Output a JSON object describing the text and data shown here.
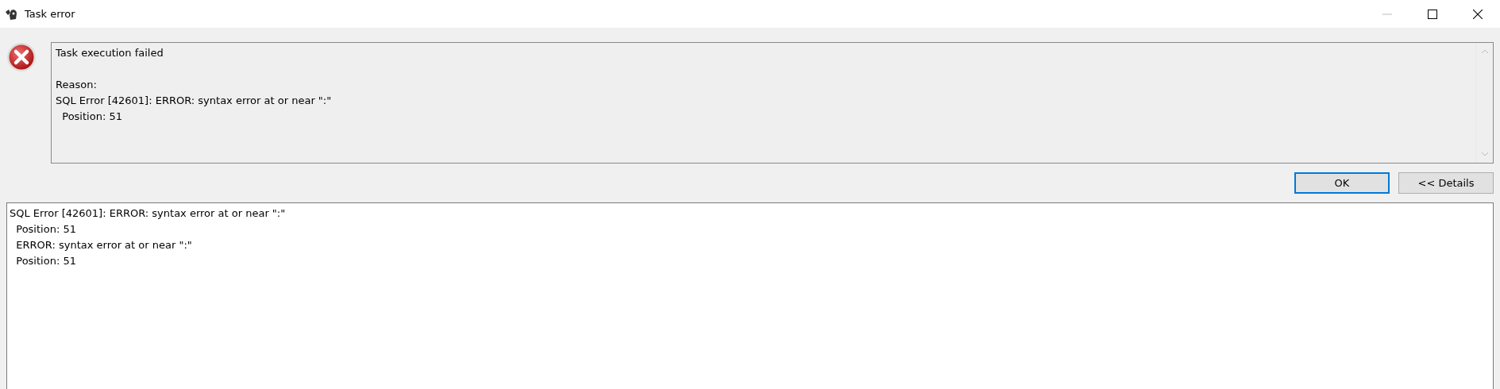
{
  "window": {
    "title": "Task error"
  },
  "message": {
    "headline": "Task execution failed",
    "reason_label": "Reason:",
    "lines": [
      "SQL Error [42601]: ERROR: syntax error at or near \":\"",
      "  Position: 51"
    ]
  },
  "buttons": [
    {
      "label": "OK",
      "default": true
    },
    {
      "label": "<< Details",
      "default": false
    }
  ],
  "details": {
    "lines": [
      "SQL Error [42601]: ERROR: syntax error at or near \":\"",
      "  Position: 51",
      "  ERROR: syntax error at or near \":\"",
      "  Position: 51"
    ]
  }
}
